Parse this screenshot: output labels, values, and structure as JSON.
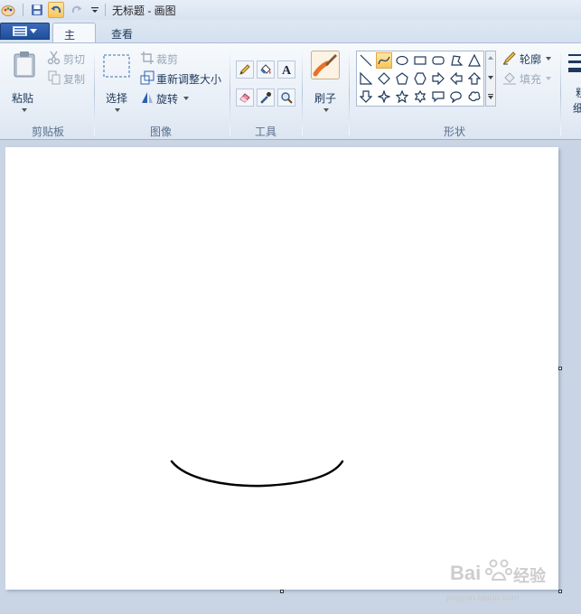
{
  "window": {
    "title": "无标题 - 画图"
  },
  "quick_access": {
    "icons": [
      "paint-app-icon",
      "save-icon",
      "undo-icon",
      "redo-icon",
      "customize-dropdown-icon"
    ]
  },
  "tabs": [
    {
      "label": "主页",
      "active": true
    },
    {
      "label": "查看",
      "active": false
    }
  ],
  "ribbon": {
    "clipboard": {
      "group_label": "剪贴板",
      "paste_label": "粘贴",
      "cut_label": "剪切",
      "copy_label": "复制"
    },
    "image": {
      "group_label": "图像",
      "select_label": "选择",
      "crop_label": "裁剪",
      "resize_label": "重新调整大小",
      "rotate_label": "旋转"
    },
    "tools": {
      "group_label": "工具",
      "items": [
        "pencil-icon",
        "fill-bucket-icon",
        "text-icon",
        "eraser-icon",
        "color-picker-icon",
        "magnifier-icon"
      ]
    },
    "brushes": {
      "label": "刷子"
    },
    "shapes": {
      "group_label": "形状",
      "outline_label": "轮廓",
      "fill_label": "填充",
      "selected_shape": "curve"
    },
    "size": {
      "label_partial": "粗",
      "label_partial2": "细"
    }
  },
  "canvas": {
    "background": "#ffffff",
    "stroke_color": "#000000"
  },
  "watermark": {
    "brand": "Bai",
    "brand2": "经验",
    "url": "jingyan.baidu.com"
  }
}
